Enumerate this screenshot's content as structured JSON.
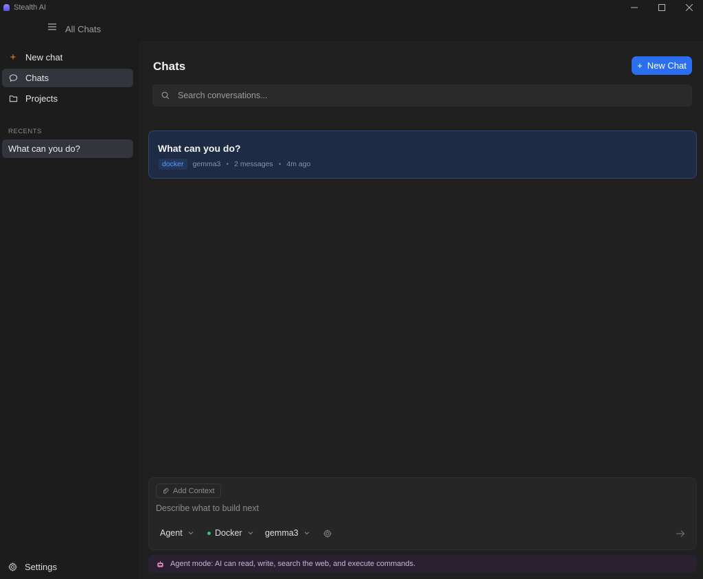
{
  "window": {
    "title": "Stealth AI"
  },
  "header": {
    "title": "All Chats"
  },
  "sidebar": {
    "items": [
      {
        "label": "New chat",
        "icon": "plus-icon"
      },
      {
        "label": "Chats",
        "icon": "chat-bubble-icon",
        "active": true
      },
      {
        "label": "Projects",
        "icon": "folder-icon"
      }
    ],
    "recents_label": "RECENTS",
    "recents": [
      {
        "label": "What can you do?"
      }
    ],
    "settings_label": "Settings"
  },
  "main": {
    "title": "Chats",
    "new_chat_label": "New Chat",
    "search": {
      "placeholder": "Search conversations...",
      "value": ""
    },
    "chats": [
      {
        "title": "What can you do?",
        "tag": "docker",
        "model": "gemma3",
        "messages": "2 messages",
        "time": "4m ago"
      }
    ]
  },
  "composer": {
    "add_context_label": "Add Context",
    "placeholder": "Describe what to build next",
    "mode": "Agent",
    "provider": "Docker",
    "model": "gemma3",
    "banner": "Agent mode: AI can read, write, search the web, and execute commands."
  },
  "colors": {
    "accent": "#2b6ef0",
    "plus_orange": "#f08a2c",
    "status_green": "#38c172",
    "tag_text": "#5c9bff"
  }
}
